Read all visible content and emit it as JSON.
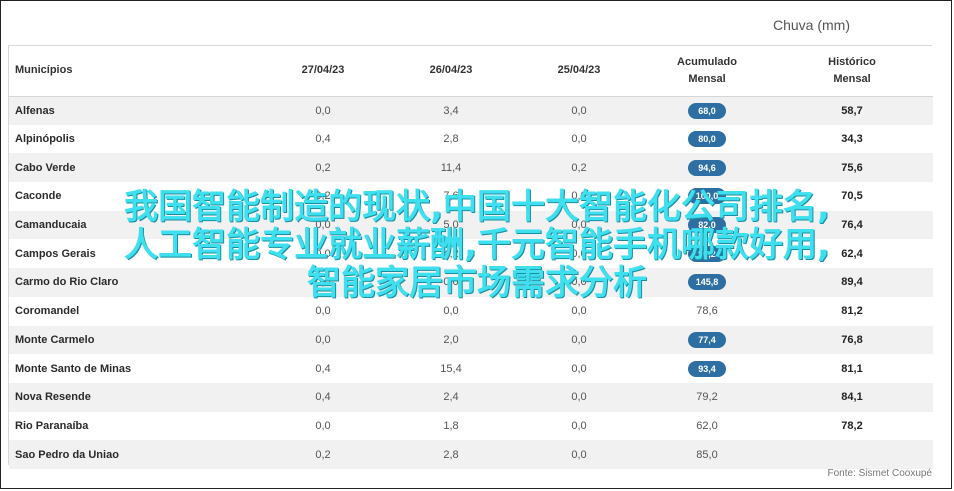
{
  "caption": "Chuva (mm)",
  "table": {
    "headers": {
      "municipio": "Municípios",
      "d1": "27/04/23",
      "d2": "26/04/23",
      "d3": "25/04/23",
      "acc_line1": "Acumulado",
      "acc_line2": "Mensal",
      "hist_line1": "Histórico",
      "hist_line2": "Mensal"
    },
    "rows": [
      {
        "name": "Alfenas",
        "d1": "0,0",
        "d2": "3,4",
        "d3": "0,0",
        "acc": "68,0",
        "hist": "58,7",
        "highlight": true
      },
      {
        "name": "Alpinópolis",
        "d1": "0,4",
        "d2": "2,8",
        "d3": "0,0",
        "acc": "80,0",
        "hist": "34,3",
        "highlight": true
      },
      {
        "name": "Cabo Verde",
        "d1": "0,2",
        "d2": "11,4",
        "d3": "0,2",
        "acc": "94,6",
        "hist": "75,6",
        "highlight": true
      },
      {
        "name": "Caconde",
        "d1": "0,2",
        "d2": "7,6",
        "d3": "0,0",
        "acc": "100,0",
        "hist": "70,5",
        "highlight": true
      },
      {
        "name": "Camanducaia",
        "d1": "0,0",
        "d2": "5,0",
        "d3": "0,0",
        "acc": "82,0",
        "hist": "76,4",
        "highlight": true
      },
      {
        "name": "Campos Gerais",
        "d1": "0,0",
        "d2": "4,2",
        "d3": "0,0",
        "acc": "90,2",
        "hist": "62,4",
        "highlight": true
      },
      {
        "name": "Carmo do Rio Claro",
        "d1": "0,0",
        "d2": "0,0",
        "d3": "0,0",
        "acc": "145,8",
        "hist": "89,4",
        "highlight": true
      },
      {
        "name": "Coromandel",
        "d1": "0,0",
        "d2": "0,0",
        "d3": "0,0",
        "acc": "78,6",
        "hist": "81,2",
        "highlight": false
      },
      {
        "name": "Monte Carmelo",
        "d1": "0,0",
        "d2": "2,0",
        "d3": "0,0",
        "acc": "77,4",
        "hist": "76,8",
        "highlight": true
      },
      {
        "name": "Monte Santo de Minas",
        "d1": "0,4",
        "d2": "15,4",
        "d3": "0,0",
        "acc": "93,4",
        "hist": "81,1",
        "highlight": true
      },
      {
        "name": "Nova Resende",
        "d1": "0,4",
        "d2": "2,4",
        "d3": "0,0",
        "acc": "79,2",
        "hist": "84,1",
        "highlight": false
      },
      {
        "name": "Rio Paranaíba",
        "d1": "0,0",
        "d2": "1,8",
        "d3": "0,0",
        "acc": "62,0",
        "hist": "78,2",
        "highlight": false
      },
      {
        "name": "Sao Pedro da Uniao",
        "d1": "0,2",
        "d2": "2,8",
        "d3": "0,0",
        "acc": "85,0",
        "hist": "",
        "highlight": false
      }
    ]
  },
  "source": "Fonte: Sismet Cooxupé",
  "overlay_lines": [
    "我国智能制造的现状,中国十大智能化公司排名,",
    "人工智能专业就业薪酬,千元智能手机哪款好用,",
    "智能家居市场需求分析"
  ],
  "colors": {
    "pill": "#2e6fa3",
    "overlay_text": "#3ee0ef",
    "stripe": "#f1f1f1"
  }
}
